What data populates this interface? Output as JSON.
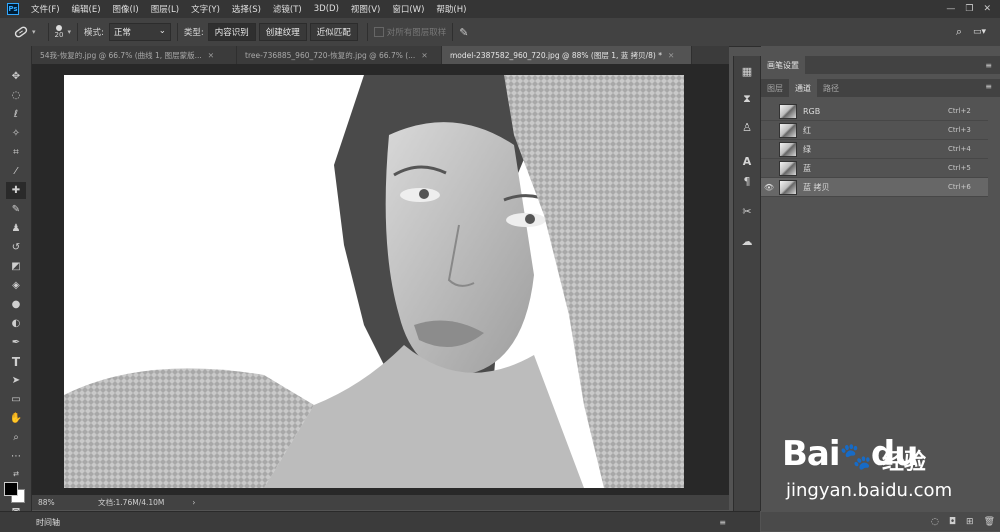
{
  "app": {
    "logo": "Ps"
  },
  "menu": [
    "文件(F)",
    "编辑(E)",
    "图像(I)",
    "图层(L)",
    "文字(Y)",
    "选择(S)",
    "滤镜(T)",
    "3D(D)",
    "视图(V)",
    "窗口(W)",
    "帮助(H)"
  ],
  "window_controls": [
    "—",
    "❐",
    "✕"
  ],
  "options": {
    "brush_size": "20",
    "mode_label": "模式:",
    "mode_value": "正常",
    "type_label": "类型:",
    "type_buttons": [
      "内容识别",
      "创建纹理",
      "近似匹配"
    ],
    "sample_all": "对所有图层取样"
  },
  "tabs": [
    {
      "label": "54我-恢复的.jpg @ 66.7% (曲线 1, 图层蒙版...",
      "active": false
    },
    {
      "label": "tree-736885_960_720-恢复的.jpg @ 66.7% (...",
      "active": false
    },
    {
      "label": "model-2387582_960_720.jpg @ 88% (图层 1, 蓝 拷贝/8) *",
      "active": true
    }
  ],
  "status": {
    "zoom": "88%",
    "doc": "文档:1.76M/4.10M",
    "arrow": "›"
  },
  "timeline": {
    "label": "时间轴"
  },
  "brush_panel": {
    "title": "画笔设置"
  },
  "panel_tabs": [
    "图层",
    "通道",
    "路径"
  ],
  "channels": [
    {
      "name": "RGB",
      "shortcut": "Ctrl+2",
      "visible": false,
      "selected": false
    },
    {
      "name": "红",
      "shortcut": "Ctrl+3",
      "visible": false,
      "selected": false
    },
    {
      "name": "绿",
      "shortcut": "Ctrl+4",
      "visible": false,
      "selected": false
    },
    {
      "name": "蓝",
      "shortcut": "Ctrl+5",
      "visible": false,
      "selected": false
    },
    {
      "name": "蓝 拷贝",
      "shortcut": "Ctrl+6",
      "visible": true,
      "selected": true
    }
  ],
  "watermark": {
    "brand": "Bai",
    "brand2": "du",
    "cn": "经验",
    "url": "jingyan.baidu.com"
  }
}
